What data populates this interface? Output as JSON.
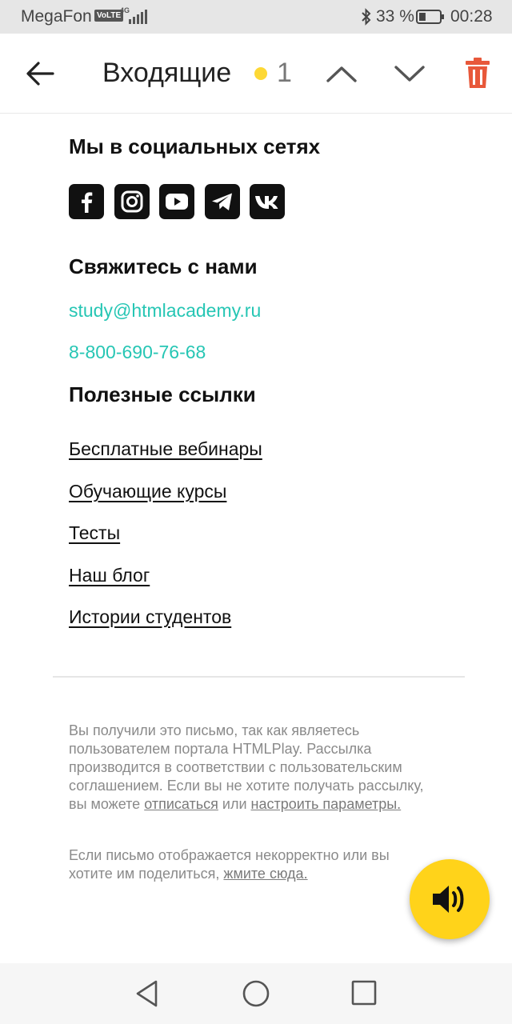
{
  "status_bar": {
    "carrier": "MegaFon",
    "volte": "VoLTE",
    "network": "4G",
    "battery_text": "33 %",
    "battery_level": 0.33,
    "time": "00:28",
    "icons": [
      "signal-icon",
      "bluetooth-icon",
      "battery-icon"
    ]
  },
  "header": {
    "title": "Входящие",
    "unread_count": "1",
    "unread_dot_color": "#fdd835",
    "trash_color": "#e8583a",
    "icons": [
      "back-arrow-icon",
      "chevron-up-icon",
      "chevron-down-icon",
      "trash-icon"
    ]
  },
  "email": {
    "social_title": "Мы в социальных сетях",
    "socials": [
      {
        "name": "facebook",
        "icon": "facebook-icon"
      },
      {
        "name": "instagram",
        "icon": "instagram-icon"
      },
      {
        "name": "youtube",
        "icon": "youtube-icon"
      },
      {
        "name": "telegram",
        "icon": "telegram-icon"
      },
      {
        "name": "vk",
        "icon": "vk-icon"
      }
    ],
    "contact_title": "Свяжитесь с нами",
    "contact_email": "study@htmlacademy.ru",
    "contact_phone": "8-800-690-76-68",
    "contact_color": "#26c6b4",
    "links_title": "Полезные ссылки",
    "links": [
      "Бесплатные вебинары",
      "Обучающие курсы",
      "Тесты",
      "Наш блог",
      "Истории студентов"
    ],
    "footer": {
      "p1_text": "Вы получили это письмо, так как являетесь пользователем портала HTMLPlay. Рассылка производится в соответствии с пользовательским соглашением. Если вы не хотите получать рассылку, вы можете",
      "unsubscribe": "отписаться",
      "or": "или",
      "settings": "настроить параметры.",
      "p2_text": "Если письмо отображается некорректно или вы хотите им поделиться,",
      "click_here": "жмите сюда."
    }
  },
  "fab": {
    "icon": "speaker-icon",
    "color": "#ffd31a"
  },
  "nav_bar": {
    "icons": [
      "nav-back-icon",
      "nav-home-icon",
      "nav-recent-icon"
    ]
  }
}
